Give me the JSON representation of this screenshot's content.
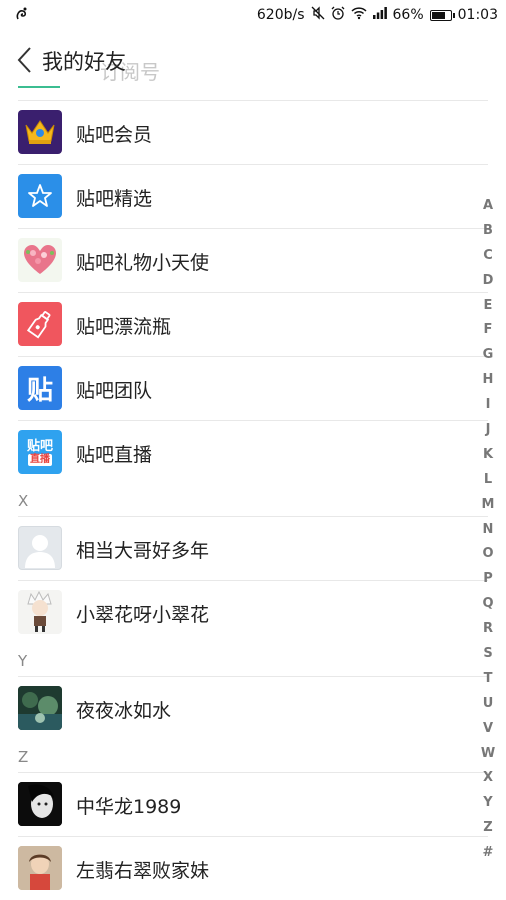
{
  "status_bar": {
    "app_icon": "squirrel-icon",
    "net_speed": "620b/s",
    "battery_text": "66%",
    "battery_level": 0.66,
    "time": "01:03",
    "icons": [
      "mute-icon",
      "alarm-icon",
      "wifi-icon",
      "signal-icon"
    ]
  },
  "header": {
    "title": "我的好友",
    "behind_text": "订阅号"
  },
  "sections": [
    {
      "letter": "",
      "items": [
        {
          "name": "贴吧会员",
          "icon": "crown-icon"
        },
        {
          "name": "贴吧精选",
          "icon": "star-icon"
        },
        {
          "name": "贴吧礼物小天使",
          "icon": "heart-icon"
        },
        {
          "name": "贴吧漂流瓶",
          "icon": "bottle-icon"
        },
        {
          "name": "贴吧团队",
          "icon": "tieba-logo-icon",
          "icon_text": "贴"
        },
        {
          "name": "贴吧直播",
          "icon": "live-icon",
          "icon_text": "贴吧",
          "icon_subtext": "直播"
        }
      ]
    },
    {
      "letter": "X",
      "items": [
        {
          "name": "相当大哥好多年"
        },
        {
          "name": "小翠花呀小翠花"
        }
      ]
    },
    {
      "letter": "Y",
      "items": [
        {
          "name": "夜夜冰如水"
        }
      ]
    },
    {
      "letter": "Z",
      "items": [
        {
          "name": "中华龙1989"
        },
        {
          "name": "左翡右翠败家妹"
        }
      ]
    }
  ],
  "index_letters": [
    "A",
    "B",
    "C",
    "D",
    "E",
    "F",
    "G",
    "H",
    "I",
    "J",
    "K",
    "L",
    "M",
    "N",
    "O",
    "P",
    "Q",
    "R",
    "S",
    "T",
    "U",
    "V",
    "W",
    "X",
    "Y",
    "Z",
    "#"
  ]
}
